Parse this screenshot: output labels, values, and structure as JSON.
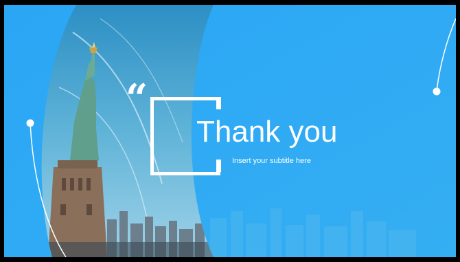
{
  "slide": {
    "title": "Thank you",
    "subtitle": "Insert your subtitle here",
    "quote_glyph": "“"
  },
  "colors": {
    "background_blue": "#2ea8f4",
    "text": "#ffffff",
    "frame": "#000000"
  },
  "image": {
    "subject": "statue-of-liberty-photo"
  }
}
